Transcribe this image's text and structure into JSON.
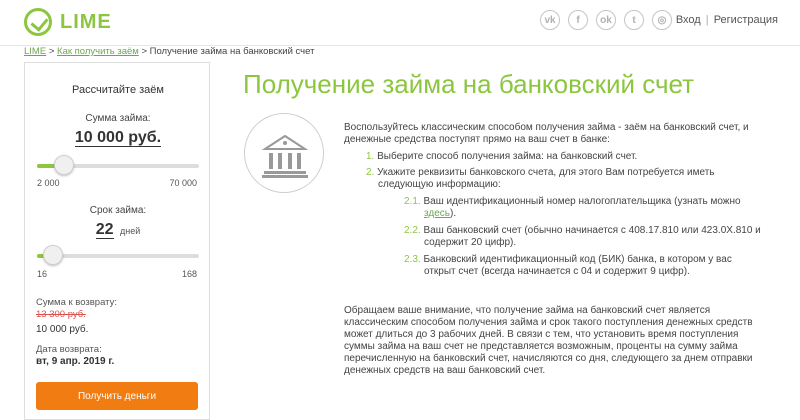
{
  "header": {
    "logo": "LIME",
    "socials": [
      {
        "icon": "vk-icon",
        "glyph": "vk"
      },
      {
        "icon": "facebook-icon",
        "glyph": "f"
      },
      {
        "icon": "odnoklassniki-icon",
        "glyph": "ok"
      },
      {
        "icon": "twitter-icon",
        "glyph": "t"
      },
      {
        "icon": "instagram-icon",
        "glyph": "◎"
      }
    ],
    "login": "Вход",
    "separator": "|",
    "register": "Регистрация"
  },
  "breadcrumb": {
    "home": "LIME",
    "sep1": ">",
    "how_to": "Как получить заём",
    "sep2": ">",
    "current": "Получение займа на банковский счет"
  },
  "calculator": {
    "title": "Рассчитайте заём",
    "amount_label": "Сумма займа:",
    "amount_value": "10 000 руб.",
    "amount_min": "2 000",
    "amount_max": "70 000",
    "amount_fraction": 0.118,
    "term_label": "Срок займа:",
    "term_value": "22",
    "term_unit": "дней",
    "term_min": "16",
    "term_max": "168",
    "term_fraction": 0.04,
    "return_label": "Сумма к возврату:",
    "return_old": "13 300 руб.",
    "return_new": "10 000 руб.",
    "date_label": "Дата возврата:",
    "date_value": "вт, 9 апр. 2019 г.",
    "button": "Получить деньги"
  },
  "main": {
    "title": "Получение займа на банковский счет",
    "intro_line1": "Воспользуйтесь классическим способом получения займа - заём на банковский счет, и",
    "intro_line2": "денежные средства поступят прямо на ваш счет в банке:",
    "steps": [
      {
        "num": "1.",
        "line1": "Выберите способ получения займа: на банковский счет."
      },
      {
        "num": "2.",
        "line1": "Укажите реквизиты банковского счета, для этого Вам потребуется иметь",
        "line2": "следующую информацию:"
      }
    ],
    "substeps": [
      {
        "num": "2.1.",
        "line1": "Ваш идентификационный номер налогоплательщика (узнать можно",
        "link": "здесь",
        "tail": ")."
      },
      {
        "num": "2.2.",
        "line1": "Ваш банковский счет (обычно начинается с 408.17.810 или 423.0X.810 и",
        "line2": "содержит 20 цифр)."
      },
      {
        "num": "2.3.",
        "line1": "Банковский идентификационный код (БИК) банка, в котором у вас",
        "line2": "открыт счет (всегда начинается с 04 и содержит 9 цифр)."
      }
    ],
    "note_lines": [
      "Обращаем ваше внимание, что получение займа на банковский счет является",
      "классическим способом получения займа и срок такого поступления денежных средств",
      "может длиться до 3 рабочих дней. В связи с тем, что установить время поступления",
      "суммы займа на ваш счет не представляется возможным, проценты на сумму займа",
      "перечисленную на банковский счет, начисляются со дня, следующего за днем отправки",
      "денежных средств на ваш банковский счет."
    ]
  },
  "colors": {
    "brand_green": "#8cc63f",
    "link_green": "#6aa84f",
    "button_orange": "#f07c12",
    "old_price_red": "#d9534f"
  }
}
